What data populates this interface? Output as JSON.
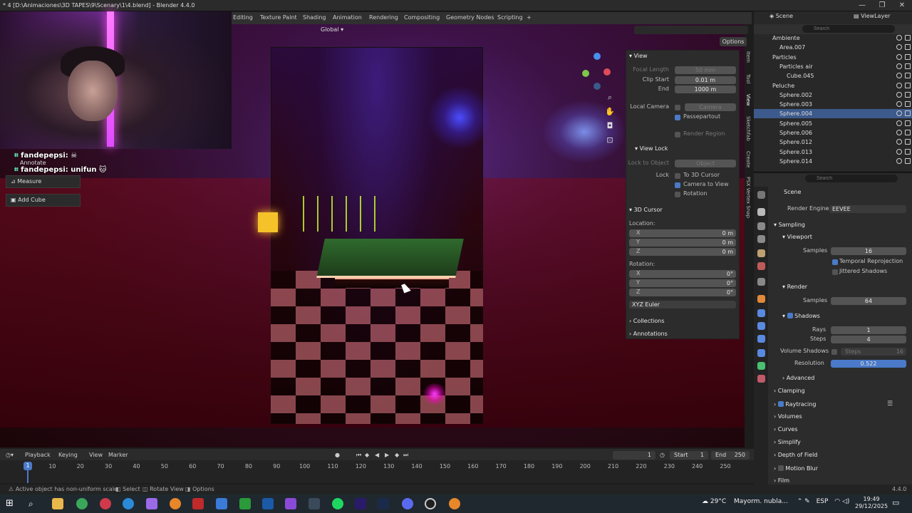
{
  "window": {
    "title": "* 4 [D:\\Animaciones\\3D TAPES\\9\\Scenary\\1\\4.blend] - Blender 4.4.0",
    "minimize": "—",
    "maximize": "❐",
    "close": "✕"
  },
  "workspaces": [
    "Editing",
    "Texture Paint",
    "Shading",
    "Animation",
    "Rendering",
    "Compositing",
    "Geometry Nodes",
    "Scripting",
    "+"
  ],
  "viewport": {
    "orientation": "Global",
    "options": "Options"
  },
  "chat": {
    "line1_user": "fandepepsi:",
    "line1_icon": "skull-icon",
    "line2_user": "fandepepsi:",
    "line2_text": "unifun"
  },
  "tools": {
    "annotate": "Annotate",
    "measure": "Measure",
    "add_cube": "Add Cube"
  },
  "npanel": {
    "view": {
      "header": "View",
      "focal_length_label": "Focal Length",
      "focal_length": "50 mm",
      "clip_start_label": "Clip Start",
      "clip_start": "0.01 m",
      "end_label": "End",
      "end": "1000 m",
      "local_camera_label": "Local Camera",
      "camera": "Camera",
      "passepartout": "Passepartout",
      "render_region": "Render Region"
    },
    "view_lock": {
      "header": "View Lock",
      "lock_to_object_label": "Lock to Object",
      "object": "Object",
      "lock_label": "Lock",
      "to_3d_cursor": "To 3D Cursor",
      "camera_to_view": "Camera to View",
      "rotation": "Rotation"
    },
    "cursor": {
      "header": "3D Cursor",
      "location_label": "Location:",
      "x_label": "X",
      "x": "0 m",
      "y_label": "Y",
      "y": "0 m",
      "z_label": "Z",
      "z": "0 m",
      "rotation_label": "Rotation:",
      "rx_label": "X",
      "rx": "0°",
      "ry_label": "Y",
      "ry": "0°",
      "rz_label": "Z",
      "rz": "0°",
      "mode": "XYZ Euler"
    },
    "collections": "Collections",
    "annotations": "Annotations"
  },
  "vtabs": [
    "Item",
    "Tool",
    "View",
    "Sketchfab",
    "Create",
    "PSX Vertex Snap"
  ],
  "outliner": {
    "scene_label": "Scene",
    "viewlayer_label": "ViewLayer",
    "search_placeholder": "Search",
    "rows": [
      {
        "name": "Ambiente",
        "indent": 2
      },
      {
        "name": "Area.007",
        "indent": 3
      },
      {
        "name": "Particles",
        "indent": 2
      },
      {
        "name": "Particles air",
        "indent": 3
      },
      {
        "name": "Cube.045",
        "indent": 4
      },
      {
        "name": "Peluche",
        "indent": 2
      },
      {
        "name": "Sphere.002",
        "indent": 3
      },
      {
        "name": "Sphere.003",
        "indent": 3
      },
      {
        "name": "Sphere.004",
        "indent": 3,
        "selected": true
      },
      {
        "name": "Sphere.005",
        "indent": 3
      },
      {
        "name": "Sphere.006",
        "indent": 3
      },
      {
        "name": "Sphere.012",
        "indent": 3
      },
      {
        "name": "Sphere.013",
        "indent": 3
      },
      {
        "name": "Sphere.014",
        "indent": 3
      }
    ]
  },
  "properties": {
    "search_placeholder": "Search",
    "scene": "Scene",
    "render_engine_label": "Render Engine",
    "render_engine": "EEVEE",
    "sampling": "Sampling",
    "viewport": "Viewport",
    "samples_label": "Samples",
    "viewport_samples": "16",
    "temporal_reprojection": "Temporal Reprojection",
    "jittered_shadows": "Jittered Shadows",
    "render": "Render",
    "render_samples_label": "Samples",
    "render_samples": "64",
    "shadows": "Shadows",
    "rays_label": "Rays",
    "rays": "1",
    "steps_label": "Steps",
    "steps": "4",
    "volume_shadows_label": "Volume Shadows",
    "vol_steps_label": "Steps",
    "vol_steps": "16",
    "resolution_label": "Resolution",
    "resolution": "0.522",
    "advanced": "Advanced",
    "clamping": "Clamping",
    "raytracing": "Raytracing",
    "volumes": "Volumes",
    "curves": "Curves",
    "simplify": "Simplify",
    "depth_of_field": "Depth of Field",
    "motion_blur": "Motion Blur",
    "film": "Film"
  },
  "timeline": {
    "playback": "Playback",
    "keying": "Keying",
    "view": "View",
    "marker": "Marker",
    "current_frame": "1",
    "start_label": "Start",
    "start": "1",
    "end_label": "End",
    "end": "250",
    "ticks": [
      "10",
      "20",
      "30",
      "40",
      "50",
      "60",
      "70",
      "80",
      "90",
      "100",
      "110",
      "120",
      "130",
      "140",
      "150",
      "160",
      "170",
      "180",
      "190",
      "200",
      "210",
      "220",
      "230",
      "240",
      "250"
    ],
    "frame_indicator": "1"
  },
  "statusbar": {
    "message": "Active object has non-uniform scale",
    "select": "Select",
    "rotate_view": "Rotate View",
    "options": "Options",
    "version": "4.4.0"
  },
  "taskbar": {
    "temperature": "29°C",
    "weather": "Mayorm. nubla...",
    "lang": "ESP",
    "time": "19:49",
    "date": "29/12/2025"
  }
}
